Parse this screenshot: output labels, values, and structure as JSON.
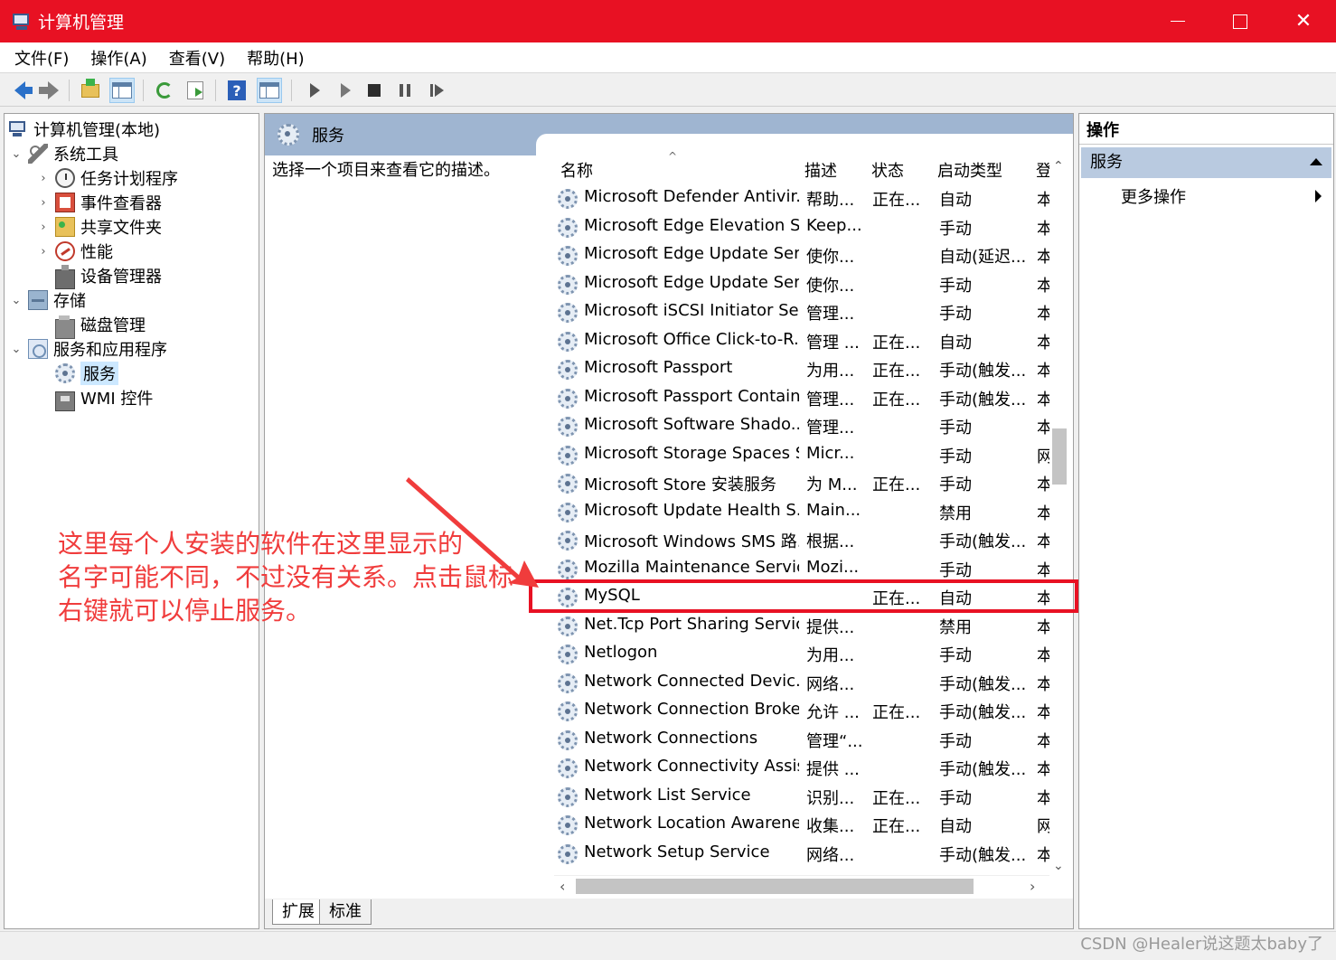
{
  "window": {
    "title": "计算机管理",
    "controls": [
      "minimize",
      "maximize",
      "close"
    ]
  },
  "menu": [
    "文件(F)",
    "操作(A)",
    "查看(V)",
    "帮助(H)"
  ],
  "toolbar": {
    "buttons": [
      "back-icon",
      "forward-icon",
      "up-folder-icon",
      "show-hide-tree-icon",
      "refresh-icon",
      "export-list-icon",
      "help-icon",
      "properties-icon",
      "start-service-icon",
      "start-service-alt-icon",
      "stop-service-icon",
      "pause-service-icon",
      "restart-service-icon"
    ]
  },
  "tree": {
    "root": "计算机管理(本地)",
    "items": [
      {
        "label": "系统工具",
        "icon": "tools-icon",
        "expanded": true
      },
      {
        "label": "任务计划程序",
        "icon": "clock-icon",
        "expanded": false
      },
      {
        "label": "事件查看器",
        "icon": "event-viewer-icon",
        "expanded": false
      },
      {
        "label": "共享文件夹",
        "icon": "shared-folder-icon",
        "expanded": false
      },
      {
        "label": "性能",
        "icon": "performance-icon",
        "expanded": false
      },
      {
        "label": "设备管理器",
        "icon": "device-manager-icon"
      },
      {
        "label": "存储",
        "icon": "storage-icon",
        "expanded": true
      },
      {
        "label": "磁盘管理",
        "icon": "disk-icon"
      },
      {
        "label": "服务和应用程序",
        "icon": "services-apps-icon",
        "expanded": true
      },
      {
        "label": "服务",
        "icon": "gear-icon",
        "selected": true
      },
      {
        "label": "WMI 控件",
        "icon": "wmi-icon"
      }
    ]
  },
  "services": {
    "header_title": "服务",
    "description_hint": "选择一个项目来查看它的描述。",
    "columns": {
      "name": "名称",
      "description": "描述",
      "status": "状态",
      "startup": "启动类型",
      "logon": "登"
    },
    "rows": [
      {
        "name": "Microsoft Defender Antivir...",
        "desc": "帮助...",
        "status": "正在...",
        "startup": "自动",
        "logon": "本"
      },
      {
        "name": "Microsoft Edge Elevation S...",
        "desc": "Keep...",
        "status": "",
        "startup": "手动",
        "logon": "本"
      },
      {
        "name": "Microsoft Edge Update Ser...",
        "desc": "使你...",
        "status": "",
        "startup": "自动(延迟...",
        "logon": "本"
      },
      {
        "name": "Microsoft Edge Update Ser...",
        "desc": "使你...",
        "status": "",
        "startup": "手动",
        "logon": "本"
      },
      {
        "name": "Microsoft iSCSI Initiator Ser...",
        "desc": "管理...",
        "status": "",
        "startup": "手动",
        "logon": "本"
      },
      {
        "name": "Microsoft Office Click-to-R...",
        "desc": "管理 ...",
        "status": "正在...",
        "startup": "自动",
        "logon": "本"
      },
      {
        "name": "Microsoft Passport",
        "desc": "为用...",
        "status": "正在...",
        "startup": "手动(触发...",
        "logon": "本"
      },
      {
        "name": "Microsoft Passport Container",
        "desc": "管理...",
        "status": "正在...",
        "startup": "手动(触发...",
        "logon": "本"
      },
      {
        "name": "Microsoft Software Shado...",
        "desc": "管理...",
        "status": "",
        "startup": "手动",
        "logon": "本"
      },
      {
        "name": "Microsoft Storage Spaces S...",
        "desc": "Micr...",
        "status": "",
        "startup": "手动",
        "logon": "网"
      },
      {
        "name": "Microsoft Store 安装服务",
        "desc": "为 M...",
        "status": "正在...",
        "startup": "手动",
        "logon": "本"
      },
      {
        "name": "Microsoft Update Health S...",
        "desc": "Main...",
        "status": "",
        "startup": "禁用",
        "logon": "本"
      },
      {
        "name": "Microsoft Windows SMS 路...",
        "desc": "根据...",
        "status": "",
        "startup": "手动(触发...",
        "logon": "本"
      },
      {
        "name": "Mozilla Maintenance Service",
        "desc": "Mozi...",
        "status": "",
        "startup": "手动",
        "logon": "本"
      },
      {
        "name": "MySQL",
        "desc": "",
        "status": "正在...",
        "startup": "自动",
        "logon": "本"
      },
      {
        "name": "Net.Tcp Port Sharing Service",
        "desc": "提供...",
        "status": "",
        "startup": "禁用",
        "logon": "本"
      },
      {
        "name": "Netlogon",
        "desc": "为用...",
        "status": "",
        "startup": "手动",
        "logon": "本"
      },
      {
        "name": "Network Connected Devic...",
        "desc": "网络...",
        "status": "",
        "startup": "手动(触发...",
        "logon": "本"
      },
      {
        "name": "Network Connection Broker",
        "desc": "允许 ...",
        "status": "正在...",
        "startup": "手动(触发...",
        "logon": "本"
      },
      {
        "name": "Network Connections",
        "desc": "管理“...",
        "status": "",
        "startup": "手动",
        "logon": "本"
      },
      {
        "name": "Network Connectivity Assis...",
        "desc": "提供 ...",
        "status": "",
        "startup": "手动(触发...",
        "logon": "本"
      },
      {
        "name": "Network List Service",
        "desc": "识别...",
        "status": "正在...",
        "startup": "手动",
        "logon": "本"
      },
      {
        "name": "Network Location Awarene...",
        "desc": "收集...",
        "status": "正在...",
        "startup": "自动",
        "logon": "网"
      },
      {
        "name": "Network Setup Service",
        "desc": "网络...",
        "status": "",
        "startup": "手动(触发...",
        "logon": "本"
      }
    ],
    "highlighted_row": "MySQL",
    "bottom_tabs": [
      "扩展",
      "标准"
    ]
  },
  "actions": {
    "title": "操作",
    "section": "服务",
    "more": "更多操作"
  },
  "annotation": {
    "lines": [
      "这里每个人安装的软件在这里显示的",
      "名字可能不同，不过没有关系。点击鼠标",
      "右键就可以停止服务。"
    ],
    "color": "#f03c3c"
  },
  "watermark": "CSDN @Healer说这题太baby了",
  "colors": {
    "titlebar": "#e81123",
    "pane_header": "#9fb5d1",
    "highlight": "#e81123"
  }
}
